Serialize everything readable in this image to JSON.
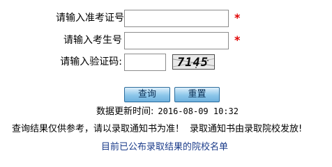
{
  "form": {
    "exam_no_label": "请输入准考证号",
    "student_no_label": "请输入考生号",
    "captcha_label": "请输入验证码:",
    "required_mark": "*",
    "exam_no_value": "",
    "student_no_value": "",
    "captcha_value": "",
    "captcha_image_text": "7145"
  },
  "buttons": {
    "query": "查询",
    "reset": "重置"
  },
  "info": {
    "update_label": "数据更新时间:",
    "update_time": "2016-08-09 10:32",
    "notice_part1": "查询结果仅供参考，请以录取通知书为准！",
    "notice_part2": "录取通知书由录取院校发放!",
    "school_list_link": "目前已公布录取结果的院校名单"
  },
  "colors": {
    "required": "#e00000",
    "link": "#1a3b8a",
    "button_border": "#2b6c9c"
  }
}
